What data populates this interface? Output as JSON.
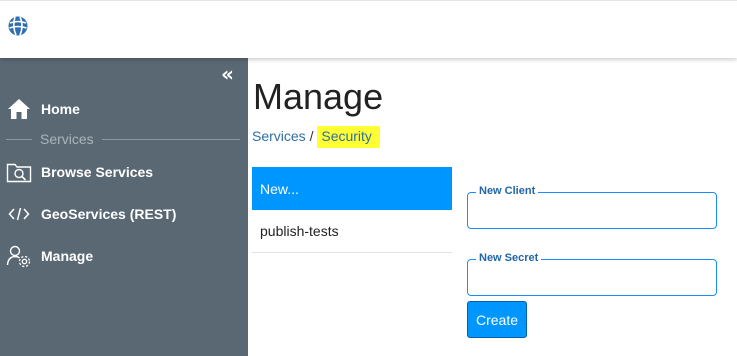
{
  "header": {
    "logo_icon": "globe-icon"
  },
  "sidebar": {
    "collapse_label": "«",
    "items": [
      {
        "label": "Home",
        "icon": "home-icon"
      },
      {
        "label": "Browse Services",
        "icon": "browse-services-icon"
      },
      {
        "label": "GeoServices (REST)",
        "icon": "code-icon"
      },
      {
        "label": "Manage",
        "icon": "user-gear-icon"
      }
    ],
    "section_label": "Services"
  },
  "main": {
    "title": "Manage",
    "breadcrumb": {
      "parent": "Services",
      "separator": "/",
      "current": "Security"
    },
    "clients": [
      {
        "label": "New...",
        "active": true
      },
      {
        "label": "publish-tests",
        "active": false
      }
    ],
    "form": {
      "client_label": "New Client",
      "client_value": "",
      "secret_label": "New Secret",
      "secret_value": "",
      "create_label": "Create"
    }
  },
  "colors": {
    "sidebar_bg": "#5a6874",
    "accent": "#0096ff",
    "highlight": "#ffff33",
    "link": "#2d6fa8"
  }
}
